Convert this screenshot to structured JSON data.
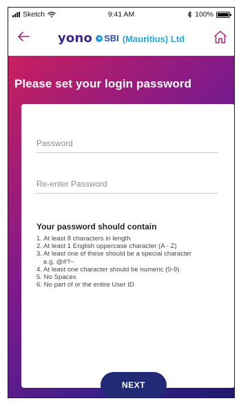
{
  "status_bar": {
    "carrier": "Sketch",
    "time": "9:41 AM",
    "battery": "100%"
  },
  "header": {
    "logo_yono": "yono",
    "logo_sbi": "SBI",
    "logo_sub": "(Mauritius) Ltd",
    "colors": {
      "yono": "#3b2689",
      "sbi": "#2a4ea8",
      "sub": "#22a7dd"
    }
  },
  "page": {
    "title": "Please set your login password"
  },
  "form": {
    "password_placeholder": "Password",
    "reenter_placeholder": "Re-enter Password"
  },
  "rules": {
    "title": "Your password should contain",
    "items": [
      "1. At least 8 characters in length",
      "2. At least 1 English uppercase character (A - Z)",
      "3. At least one of these should be a special character",
      "e.g. @#?~",
      "4. At least one character should be numeric (0-9)",
      "5. No Spaces",
      "6. No part of or the entire User ID"
    ]
  },
  "next_label": "NEXT",
  "colors": {
    "gradient_start": "#c81f5f",
    "gradient_end": "#1e1a6e",
    "button": "#232a75"
  },
  "icons": [
    "back-arrow-icon",
    "home-icon",
    "signal-icon",
    "wifi-icon",
    "bluetooth-icon",
    "battery-icon"
  ]
}
